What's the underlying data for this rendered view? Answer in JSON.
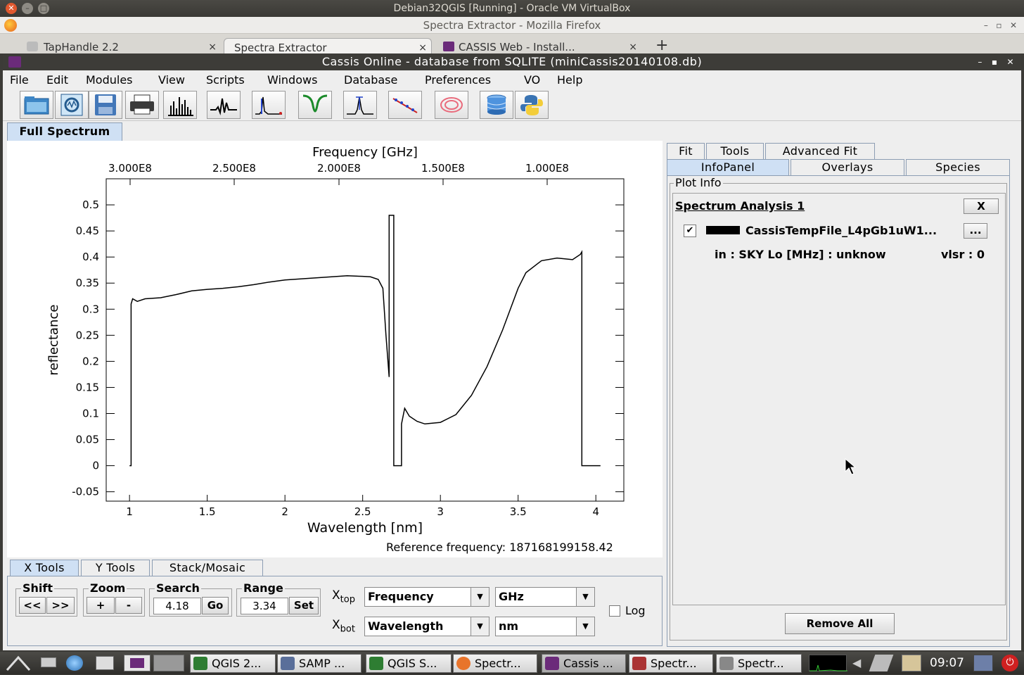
{
  "vbox": {
    "title": "Debian32QGIS [Running] - Oracle VM VirtualBox"
  },
  "firefox": {
    "title": "Spectra Extractor - Mozilla Firefox",
    "tabs": [
      {
        "label": "TapHandle 2.2"
      },
      {
        "label": "Spectra Extractor"
      },
      {
        "label": "CASSIS Web - Install..."
      }
    ],
    "new_tab": "+",
    "close_glyph": "×"
  },
  "cassis": {
    "title": "Cassis Online - database from SQLITE (miniCassis20140108.db)",
    "menu": [
      "File",
      "Edit",
      "Modules",
      "View",
      "Scripts",
      "Windows",
      "Database",
      "Preferences",
      "VO",
      "Help"
    ],
    "toolbar_icons": [
      "open-folder-icon",
      "open-spectrum-icon",
      "save-icon",
      "print-icon",
      "line-spectrum-icon",
      "spectrum-icon",
      "spectrum-analysis-icon",
      "line-profile-icon",
      "peak-icon",
      "rotational-diagram-icon",
      "loomis-icon",
      "database-icon",
      "python-icon"
    ],
    "main_tab": "Full Spectrum"
  },
  "plot": {
    "top_axis_title": "Frequency [GHz]",
    "top_ticks": [
      "3.000E8",
      "2.500E8",
      "2.000E8",
      "1.500E8",
      "1.000E8"
    ],
    "reference_label": "Reference frequency: 187168199158.42"
  },
  "chart_data": {
    "type": "line",
    "title": "",
    "xlabel": "Wavelength [nm]",
    "ylabel": "reflectance",
    "xlim": [
      0.85,
      4.18
    ],
    "ylim": [
      -0.068,
      0.55
    ],
    "xticks": [
      1,
      1.5,
      2,
      2.5,
      3,
      3.5,
      4
    ],
    "xtick_labels": [
      "1",
      "1.5",
      "2",
      "2.5",
      "3",
      "3.5",
      "4"
    ],
    "yticks": [
      -0.05,
      0,
      0.05,
      0.1,
      0.15,
      0.2,
      0.25,
      0.3,
      0.35,
      0.4,
      0.45,
      0.5
    ],
    "ytick_labels": [
      "-0.05",
      "0",
      "0.05",
      "0.1",
      "0.15",
      "0.2",
      "0.25",
      "0.3",
      "0.35",
      "0.4",
      "0.45",
      "0.5"
    ],
    "series": [
      {
        "color": "#000000",
        "points": [
          [
            1.0,
            0.0
          ],
          [
            1.01,
            0.0
          ],
          [
            1.01,
            0.31
          ],
          [
            1.02,
            0.32
          ],
          [
            1.05,
            0.315
          ],
          [
            1.1,
            0.32
          ],
          [
            1.2,
            0.322
          ],
          [
            1.3,
            0.328
          ],
          [
            1.4,
            0.335
          ],
          [
            1.5,
            0.338
          ],
          [
            1.6,
            0.34
          ],
          [
            1.7,
            0.343
          ],
          [
            1.8,
            0.347
          ],
          [
            1.9,
            0.352
          ],
          [
            2.0,
            0.356
          ],
          [
            2.1,
            0.358
          ],
          [
            2.2,
            0.36
          ],
          [
            2.3,
            0.362
          ],
          [
            2.4,
            0.364
          ],
          [
            2.5,
            0.363
          ],
          [
            2.55,
            0.362
          ],
          [
            2.6,
            0.357
          ],
          [
            2.63,
            0.34
          ],
          [
            2.65,
            0.25
          ],
          [
            2.67,
            0.17
          ],
          [
            2.67,
            0.48
          ],
          [
            2.7,
            0.48
          ],
          [
            2.7,
            0.0
          ],
          [
            2.75,
            0.0
          ],
          [
            2.75,
            0.08
          ],
          [
            2.77,
            0.11
          ],
          [
            2.8,
            0.095
          ],
          [
            2.85,
            0.085
          ],
          [
            2.9,
            0.08
          ],
          [
            3.0,
            0.083
          ],
          [
            3.1,
            0.098
          ],
          [
            3.2,
            0.135
          ],
          [
            3.3,
            0.19
          ],
          [
            3.4,
            0.26
          ],
          [
            3.5,
            0.34
          ],
          [
            3.55,
            0.37
          ],
          [
            3.65,
            0.393
          ],
          [
            3.75,
            0.398
          ],
          [
            3.85,
            0.395
          ],
          [
            3.9,
            0.405
          ],
          [
            3.91,
            0.41
          ],
          [
            3.91,
            0.0
          ],
          [
            4.03,
            0.0
          ]
        ]
      }
    ]
  },
  "right_panel": {
    "tabs_row1": [
      "Fit",
      "Tools",
      "Advanced Fit"
    ],
    "tabs_row2": [
      "InfoPanel",
      "Overlays",
      "Species"
    ],
    "plot_info_label": "Plot Info",
    "analysis_title": "Spectrum Analysis 1",
    "close_label": "X",
    "file_name": "CassisTempFile_L4pGb1uW1...",
    "more_label": "...",
    "checked": true,
    "info_line": "in : SKY Lo [MHz] : unknow",
    "vlsr": "vlsr : 0",
    "remove_all": "Remove All"
  },
  "bottom_tools": {
    "tabs": [
      "X Tools",
      "Y Tools",
      "Stack/Mosaic"
    ],
    "shift_label": "Shift",
    "shift_left": "<<",
    "shift_right": ">>",
    "zoom_label": "Zoom",
    "zoom_in": "+",
    "zoom_out": "-",
    "search_label": "Search",
    "search_value": "4.18",
    "go_label": "Go",
    "range_label": "Range",
    "range_value": "3.34",
    "set_label": "Set",
    "xtop_label": "X",
    "xtop_sub": "top",
    "xtop_type": "Frequency",
    "xtop_unit": "GHz",
    "xbot_label": "X",
    "xbot_sub": "bot",
    "xbot_type": "Wavelength",
    "xbot_unit": "nm",
    "log_label": "Log",
    "log_checked": false
  },
  "taskbar": {
    "items": [
      {
        "label": "QGIS 2...",
        "color": "#2e7d32"
      },
      {
        "label": "SAMP ...",
        "color": "#5a6f9a"
      },
      {
        "label": "QGIS S...",
        "color": "#2e7d32"
      },
      {
        "label": "Spectr...",
        "color": "#e8742b"
      },
      {
        "label": "Cassis ...",
        "color": "#6b2b7a"
      },
      {
        "label": "Spectr...",
        "color": "#a33"
      },
      {
        "label": "Spectr...",
        "color": "#888"
      }
    ],
    "clock": "09:07"
  }
}
